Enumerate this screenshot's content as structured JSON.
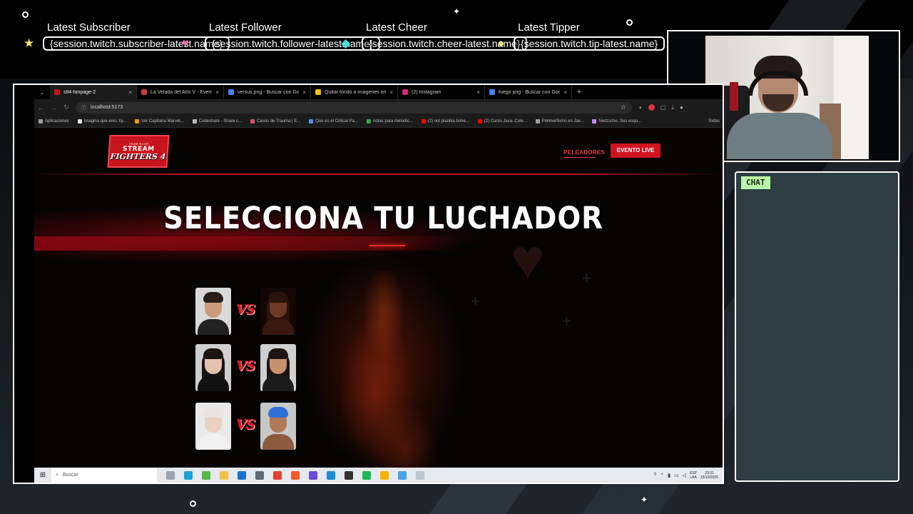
{
  "overlay": {
    "events": [
      {
        "title": "Latest Subscriber",
        "value": "{session.twitch.subscriber-latest.name}",
        "icon": "star-icon",
        "icon_glyph": "★",
        "icon_color": "#f4e36a"
      },
      {
        "title": "Latest Follower",
        "value": "{session.twitch.follower-latest.name}",
        "icon": "heart-icon",
        "icon_glyph": "♥",
        "icon_color": "#f06aa8"
      },
      {
        "title": "Latest Cheer",
        "value": "{session.twitch.cheer-latest.name}",
        "icon": "diamond-icon",
        "icon_glyph": "◆",
        "icon_color": "#4fd8d3"
      },
      {
        "title": "Latest Tipper",
        "value": "{session.twitch.tip-latest.name}",
        "icon": "coin-icon",
        "icon_glyph": "●",
        "icon_color": "#e7ea7a"
      }
    ],
    "chat_label": "CHAT"
  },
  "browser": {
    "tabs": [
      {
        "title": "stf4-fanpage-2",
        "favicon_color": "#c8141e",
        "active": true
      },
      {
        "title": "La Velada del Año V - Evento d",
        "favicon_color": "#d23a3a",
        "active": false
      },
      {
        "title": "versus png - Buscar con Google",
        "favicon_color": "#4285f4",
        "active": false
      },
      {
        "title": "Quitar fondo a imagenes onlin",
        "favicon_color": "#f2c200",
        "active": false
      },
      {
        "title": "(2) Instagram",
        "favicon_color": "#d6297a",
        "active": false
      },
      {
        "title": "fuego png - Buscar con Google",
        "favicon_color": "#4285f4",
        "active": false
      }
    ],
    "url": "localhost:5173",
    "bookmarks": [
      {
        "label": "Aplicaciones",
        "color": "#9aa0a6"
      },
      {
        "label": "Imagina que eres Xy...",
        "color": "#e3e3e3"
      },
      {
        "label": "Ver Capitana Marvel...",
        "color": "#f29900"
      },
      {
        "label": "Codeshare - Share c...",
        "color": "#bbbbbb"
      },
      {
        "label": "Casos de Trauma | E...",
        "color": "#d9534f"
      },
      {
        "label": "Que es el Critical Pa...",
        "color": "#5b8def"
      },
      {
        "label": "notas para melodic...",
        "color": "#34a853"
      },
      {
        "label": "(2) not pianika bohe...",
        "color": "#ff0000"
      },
      {
        "label": "(2) Curso Java. Cole...",
        "color": "#ff0000"
      },
      {
        "label": "Polimorfismo en Jav...",
        "color": "#9aa0a6"
      },
      {
        "label": "Nietzsche. Sus esqu...",
        "color": "#c58af9"
      }
    ],
    "all_bookmarks": "Todos"
  },
  "site": {
    "logo_small": "TEAM RUSH",
    "logo_top": "STREAM",
    "logo_bottom": "FIGHTERS 4",
    "nav_fighters": "PELEADORES",
    "live_button": "EVENTO LIVE",
    "title": "SELECCIONA TU LUCHADOR",
    "vs_label": "VS",
    "matchups": [
      {
        "left": {
          "skin": "#c89b7d",
          "hair": "#2a1e18",
          "shirt": "#222222",
          "bg": "#d9d9d9",
          "long_hair": false
        },
        "right": {
          "skin": "#6a3a26",
          "hair": "#2a120a",
          "shirt": "#3a1a10",
          "bg": "#140705",
          "long_hair": true
        }
      },
      {
        "left": {
          "skin": "#e4c2ad",
          "hair": "#1a1413",
          "shirt": "#111111",
          "bg": "#cfcfcf",
          "long_hair": true
        },
        "right": {
          "skin": "#c9926f",
          "hair": "#1d1512",
          "shirt": "#1c1c1c",
          "bg": "#d0d0d0",
          "long_hair": true
        }
      },
      {
        "left": {
          "skin": "#ead1c0",
          "hair": "#e8e4e0",
          "shirt": "#f0f0f0",
          "bg": "#e9e9e9",
          "long_hair": false
        },
        "right": {
          "skin": "#b07a58",
          "hair": "#2f6fd8",
          "shirt": "#8c5b3e",
          "bg": "#c7c7c7",
          "long_hair": false
        }
      }
    ]
  },
  "taskbar": {
    "search_placeholder": "Buscar",
    "apps": [
      {
        "name": "edge-icon",
        "color": "#1fa0d8"
      },
      {
        "name": "app-green-icon",
        "color": "#58b947"
      },
      {
        "name": "file-explorer-icon",
        "color": "#f5c244"
      },
      {
        "name": "outlook-icon",
        "color": "#1a73c8"
      },
      {
        "name": "app-gray-icon",
        "color": "#5d6b7a"
      },
      {
        "name": "chrome-icon",
        "color": "#e34133"
      },
      {
        "name": "brave-icon",
        "color": "#f15b2a"
      },
      {
        "name": "app-purple-icon",
        "color": "#6a4bd8"
      },
      {
        "name": "vscode-icon",
        "color": "#1f8ad6"
      },
      {
        "name": "app-dark-icon",
        "color": "#333333"
      },
      {
        "name": "spotify-icon",
        "color": "#1db954"
      },
      {
        "name": "drive-icon",
        "color": "#f4b400"
      },
      {
        "name": "app-blue-icon",
        "color": "#4aa3df"
      },
      {
        "name": "app-light-icon",
        "color": "#b8c4d0"
      }
    ],
    "lang_top": "ESP",
    "lang_bottom": "LAA",
    "time": "23:31",
    "date": "15/10/2025"
  }
}
